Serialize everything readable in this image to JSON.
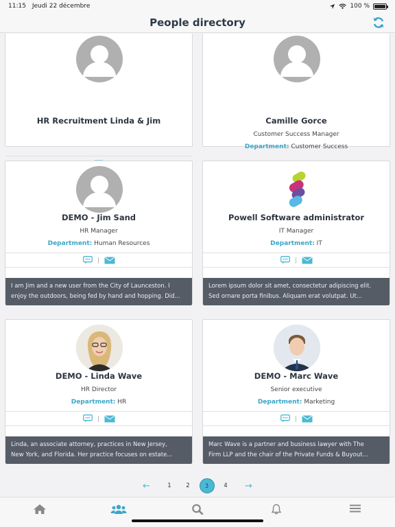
{
  "status_bar": {
    "time": "11:15",
    "date": "Jeudi 22 décembre",
    "battery": "100 %"
  },
  "header": {
    "title": "People directory"
  },
  "colors": {
    "accent": "#4bb9d3",
    "bio_background": "#555c66",
    "department_label": "#3aa6c8"
  },
  "people": [
    {
      "name": "HR Recruitment Linda & Jim",
      "title": "",
      "department": "",
      "has_chat": false,
      "bio": []
    },
    {
      "name": "Camille Gorce",
      "title": "Customer Success Manager",
      "department": "Customer Success",
      "has_chat": false,
      "bio": []
    },
    {
      "name": "DEMO - Jim Sand",
      "title": "HR Manager",
      "department": "Human Resources",
      "has_chat": true,
      "bio": [
        "I am Jim and a new user from the City of Launceston. I",
        "enjoy the outdoors, being fed by hand and hopping. Did..."
      ]
    },
    {
      "name": "Powell Software administrator",
      "title": "IT Manager",
      "department": "IT",
      "has_chat": true,
      "bio": [
        "Lorem ipsum dolor sit amet, consectetur adipiscing elit.",
        "Sed ornare porta finibus. Aliquam erat volutpat. Ut..."
      ]
    },
    {
      "name": "DEMO - Linda Wave",
      "title": "HR Director",
      "department": "HR",
      "has_chat": true,
      "bio": [
        "Linda, an associate attorney, practices in New Jersey,",
        "New York, and Florida. Her practice focuses on estate..."
      ]
    },
    {
      "name": "DEMO - Marc Wave",
      "title": "Senior executive",
      "department": "Marketing",
      "has_chat": true,
      "bio": [
        "Marc Wave is a partner and business lawyer with The",
        "Firm LLP and the chair of the Private Funds & Buyout..."
      ]
    }
  ],
  "department_label": "Department:",
  "pagination": {
    "prev": "←",
    "next": "→",
    "pages": [
      "1",
      "2",
      "3",
      "4"
    ],
    "current": "3"
  },
  "tabs": [
    "home-icon",
    "people-icon",
    "search-icon",
    "bell-icon",
    "menu-icon"
  ]
}
